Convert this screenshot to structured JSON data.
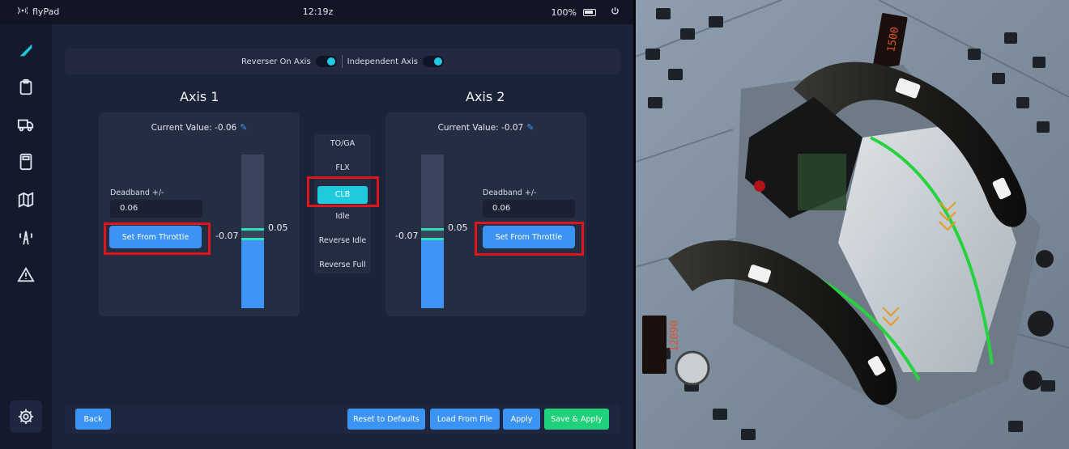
{
  "status_bar": {
    "app_name": "flyPad",
    "time": "12:19z",
    "battery": "100%"
  },
  "toggles": {
    "reverser_label": "Reverser On Axis",
    "independent_label": "Independent Axis"
  },
  "axis1": {
    "title": "Axis 1",
    "current_value_label": "Current Value: -0.06",
    "deadband_label": "Deadband +/-",
    "deadband_value": "0.06",
    "set_button": "Set From Throttle",
    "bar_left_value": "-0.07",
    "bar_right_value": "0.05",
    "bar_fill_fraction": 0.45,
    "bar_line_fractions": [
      0.52,
      0.46
    ]
  },
  "axis2": {
    "title": "Axis 2",
    "current_value_label": "Current Value: -0.07",
    "deadband_label": "Deadband +/-",
    "deadband_value": "0.06",
    "set_button": "Set From Throttle",
    "bar_left_value": "-0.07",
    "bar_right_value": "0.05",
    "bar_fill_fraction": 0.45,
    "bar_line_fractions": [
      0.52,
      0.46
    ]
  },
  "detents": {
    "items": [
      "TO/GA",
      "FLX",
      "CLB",
      "Idle",
      "Reverse Idle",
      "Reverse Full"
    ],
    "selected": "CLB"
  },
  "bottom_bar": {
    "back": "Back",
    "reset": "Reset to Defaults",
    "load": "Load From File",
    "apply": "Apply",
    "save_apply": "Save & Apply"
  },
  "cockpit_display": {
    "top_readout": "1500",
    "bottom_readout": "12090"
  },
  "colors": {
    "accent_blue": "#3b93f3",
    "cyan": "#1fcadf",
    "green": "#1fd17b",
    "highlight_red": "#e0141c",
    "panel": "#1b2338"
  },
  "icons": [
    "wifi-icon",
    "battery-icon",
    "power-icon",
    "logo-icon",
    "clipboard-icon",
    "truck-icon",
    "calculator-icon",
    "map-icon",
    "tower-icon",
    "warning-icon",
    "gear-icon",
    "edit-icon"
  ]
}
